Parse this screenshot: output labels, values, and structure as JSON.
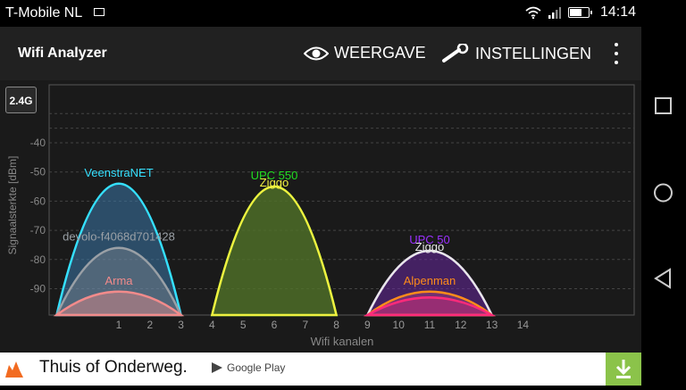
{
  "status_bar": {
    "carrier": "T-Mobile NL",
    "time": "14:14"
  },
  "app_bar": {
    "title": "Wifi Analyzer",
    "view_label": "WEERGAVE",
    "settings_label": "INSTELLINGEN"
  },
  "band_button": "2.4G",
  "chart_data": {
    "type": "area",
    "ylabel": "Signaalsterkte [dBm]",
    "xlabel": "Wifi kanalen",
    "y_ticks": [
      "-40",
      "-50",
      "-60",
      "-70",
      "-80",
      "-90"
    ],
    "x_ticks": [
      "1",
      "2",
      "3",
      "4",
      "5",
      "6",
      "7",
      "8",
      "9",
      "10",
      "11",
      "12",
      "13",
      "14"
    ],
    "series": [
      {
        "name": "VeenstraNET",
        "channel": 1,
        "dbm": -54,
        "color": "#35e0ff",
        "fill": "rgba(60,120,170,0.55)"
      },
      {
        "name": "devolo-f4068d701428",
        "channel": 1,
        "dbm": -76,
        "color": "#9aa0a6",
        "fill": "rgba(150,150,155,0.35)"
      },
      {
        "name": "Arma",
        "channel": 1,
        "dbm": -91,
        "color": "#f28b8b",
        "fill": "rgba(230,140,140,0.45)"
      },
      {
        "name": "UPC 550",
        "channel": 6,
        "dbm": -55,
        "color": "#22dd22",
        "fill": "rgba(80,120,40,0.6)"
      },
      {
        "name": "Ziggo",
        "channel": 6,
        "dbm": -55,
        "color": "#f0f040",
        "fill": "rgba(80,110,40,0.5)"
      },
      {
        "name": "UPC 50",
        "channel": 11,
        "dbm": -77,
        "color": "#9b30ff",
        "fill": "rgba(110,40,170,0.5)"
      },
      {
        "name": "Ziggo",
        "channel": 11,
        "dbm": -77,
        "color": "#e8e8e8",
        "fill": "rgba(0,0,0,0)"
      },
      {
        "name": "Alpenman",
        "channel": 11,
        "dbm": -91,
        "color": "#ff8c1a",
        "fill": "rgba(200,80,140,0.35)"
      },
      {
        "name": "",
        "channel": 11,
        "dbm": -93,
        "color": "#ff2a7a",
        "fill": "rgba(220,40,120,0.35)"
      }
    ]
  },
  "ad": {
    "text": "Thuis of Onderweg.",
    "store": "Google Play"
  },
  "nav": {
    "recents": "recents-square",
    "home": "home-circle",
    "back": "back-triangle"
  }
}
